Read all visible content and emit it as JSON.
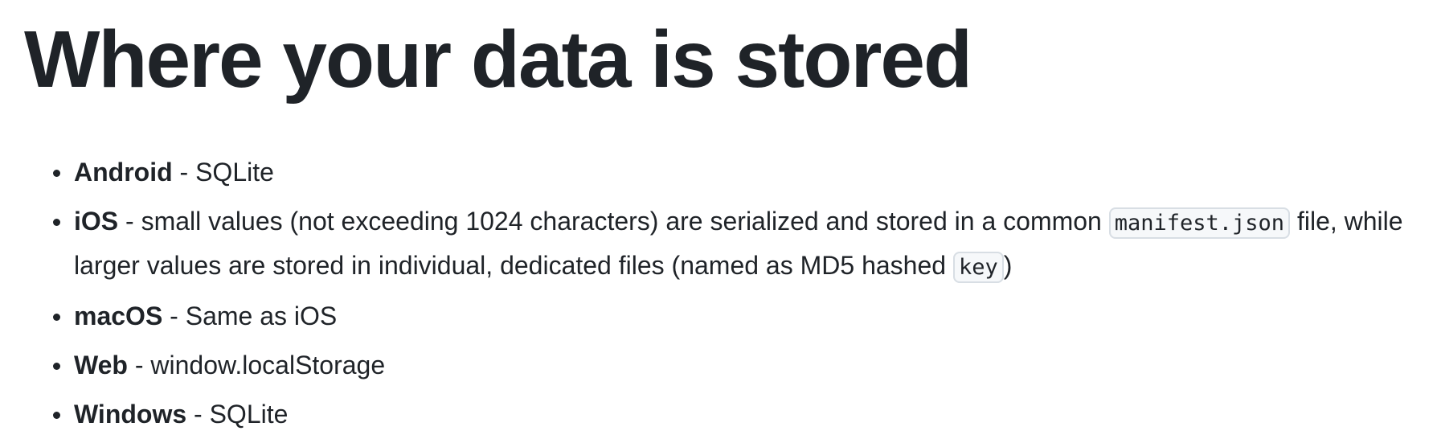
{
  "heading": "Where your data is stored",
  "items": [
    {
      "platform": "Android",
      "sep": " - ",
      "text": "SQLite"
    },
    {
      "platform": "iOS",
      "sep": " - ",
      "text_before_code_1": "small values (not exceeding 1024 characters) are serialized and stored in a common ",
      "code_1": "manifest.json",
      "text_after_code_1": " file, while larger values are stored in individual, dedicated files (named as MD5 hashed ",
      "code_2": "key",
      "text_after_code_2": ")"
    },
    {
      "platform": "macOS",
      "sep": " - ",
      "text": "Same as iOS"
    },
    {
      "platform": "Web",
      "sep": " - ",
      "text": "window.localStorage"
    },
    {
      "platform": "Windows",
      "sep": " - ",
      "text": "SQLite"
    }
  ]
}
